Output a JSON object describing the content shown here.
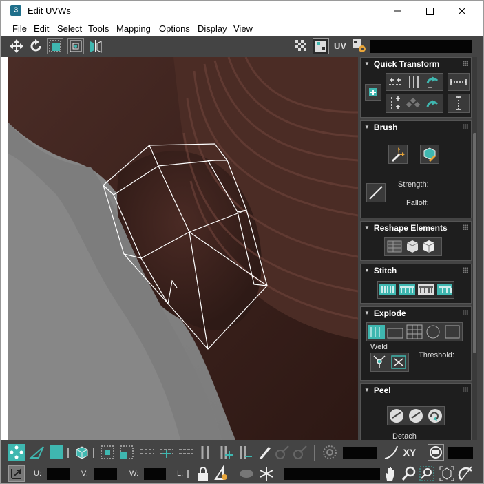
{
  "window": {
    "title": "Edit UVWs",
    "app_icon": "3",
    "minimize_icon": "minimize-icon",
    "maximize_icon": "maximize-icon",
    "close_icon": "close-icon"
  },
  "menu": [
    "File",
    "Edit",
    "Select",
    "Tools",
    "Mapping",
    "Options",
    "Display",
    "View"
  ],
  "toolbar": {
    "uv_label": "UV"
  },
  "panel": {
    "quick_transform": {
      "title": "Quick Transform"
    },
    "brush": {
      "title": "Brush",
      "strength_label": "Strength:",
      "falloff_label": "Falloff:"
    },
    "reshape": {
      "title": "Reshape Elements"
    },
    "stitch": {
      "title": "Stitch"
    },
    "explode": {
      "title": "Explode",
      "weld_label": "Weld",
      "threshold_label": "Threshold:"
    },
    "peel": {
      "title": "Peel",
      "detach_label": "Detach"
    }
  },
  "bottom": {
    "xy_label": "XY",
    "u_label": "U:",
    "v_label": "V:",
    "w_label": "W:",
    "l_label": "L:"
  },
  "colors": {
    "toolbar_bg": "#444444",
    "panel_bg": "#1e1e1e",
    "accent_teal": "#3fb7b0",
    "uv_wire": "#ffffff"
  }
}
